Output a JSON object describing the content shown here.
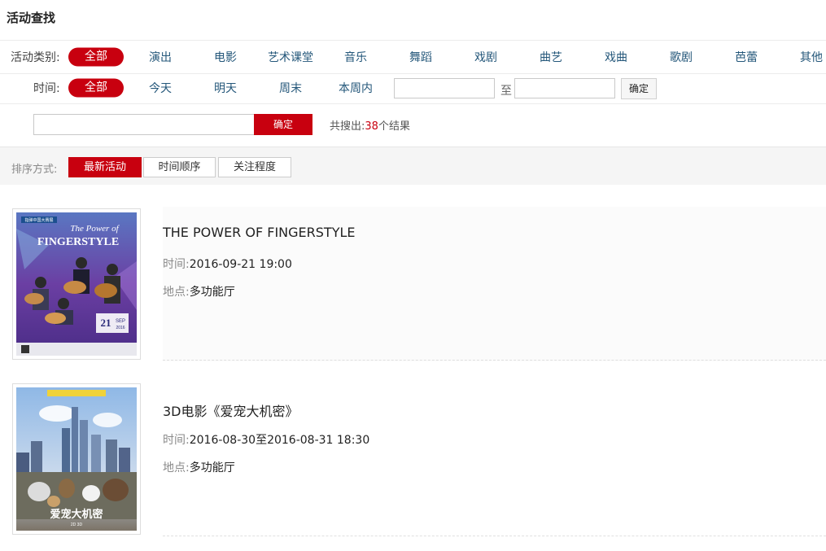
{
  "page_title": "活动查找",
  "category": {
    "label": "活动类别:",
    "options": [
      "全部",
      "演出",
      "电影",
      "艺术课堂",
      "音乐",
      "舞蹈",
      "戏剧",
      "曲艺",
      "戏曲",
      "歌剧",
      "芭蕾",
      "其他"
    ]
  },
  "time": {
    "label": "时间:",
    "options": [
      "全部",
      "今天",
      "明天",
      "周末",
      "本周内"
    ],
    "range_separator": "至",
    "from_value": "",
    "to_value": "",
    "confirm_label": "确定"
  },
  "search": {
    "value": "",
    "button_label": "确定",
    "result_prefix": "共搜出:",
    "result_count": "38",
    "result_suffix": "个结果"
  },
  "sort": {
    "label": "排序方式:",
    "options": [
      "最新活动",
      "时间顺序",
      "关注程度"
    ]
  },
  "events": [
    {
      "title": "THE POWER OF FINGERSTYLE",
      "time_key": "时间:",
      "time": "2016-09-21  19:00",
      "place_key": "地点:",
      "place": "多功能厅",
      "poster": {
        "header": "指弹中国大赛展",
        "title_line1": "The Power of",
        "title_line2": "FINGERSTYLE",
        "date_num": "21",
        "date_mon": "SEP",
        "date_year": "2016"
      }
    },
    {
      "title": "3D电影《爱宠大机密》",
      "time_key": "时间:",
      "time": "2016-08-30至2016-08-31  18:30",
      "place_key": "地点:",
      "place": "多功能厅",
      "poster": {
        "title": "爱宠大机密",
        "sub": "2D 3D"
      }
    }
  ],
  "colors": {
    "accent": "#c8000f",
    "link": "#24577a"
  }
}
